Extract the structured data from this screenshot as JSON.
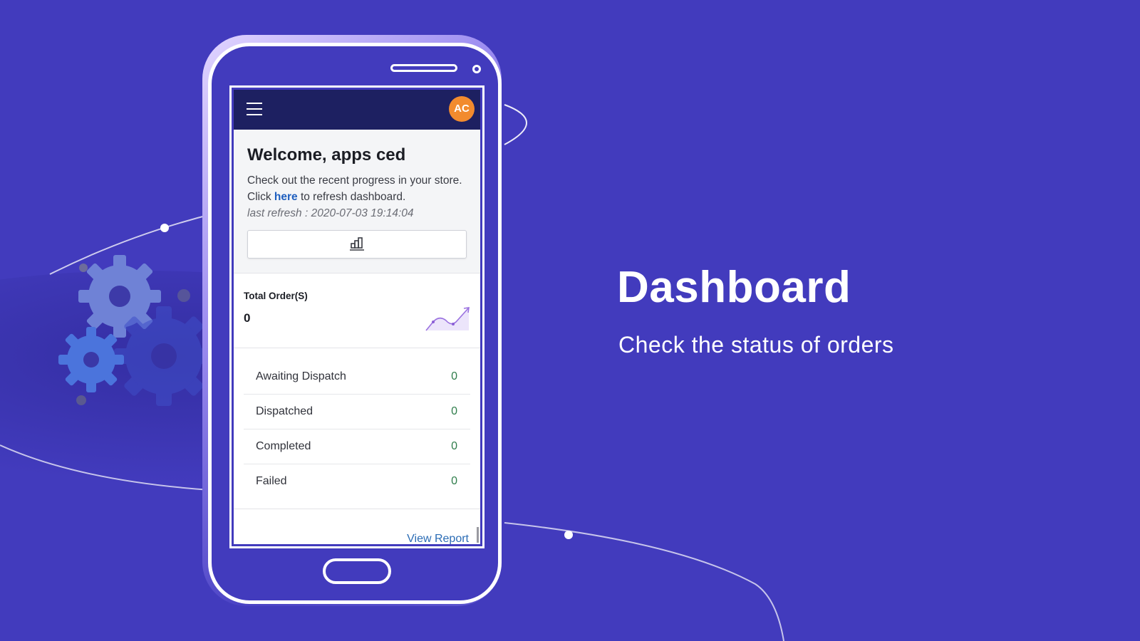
{
  "hero": {
    "title": "Dashboard",
    "subtitle": "Check the status of orders"
  },
  "app": {
    "topbar": {
      "menu_icon": "hamburger-menu-icon",
      "avatar_initials": "AC",
      "avatar_color": "#f28b2e",
      "bar_color": "#1d2061"
    },
    "welcome": {
      "heading": "Welcome, apps ced",
      "text_before_link": "Check out the recent progress in your store. Click ",
      "link_label": "here",
      "text_after_link": " to refresh dashboard.",
      "last_refresh": "last refresh : 2020-07-03 19:14:04",
      "chart_button_icon": "bar-chart-icon"
    },
    "total_orders": {
      "label": "Total Order(S)",
      "value": "0",
      "sparkline_icon": "trend-up-sparkline-icon"
    },
    "statuses": [
      {
        "label": "Awaiting Dispatch",
        "value": "0"
      },
      {
        "label": "Dispatched",
        "value": "0"
      },
      {
        "label": "Completed",
        "value": "0"
      },
      {
        "label": "Failed",
        "value": "0"
      }
    ],
    "view_report_label": "View Report"
  },
  "colors": {
    "background": "#423bbd",
    "accent_link": "#1f5fbf",
    "status_value": "#2f7d4b"
  }
}
